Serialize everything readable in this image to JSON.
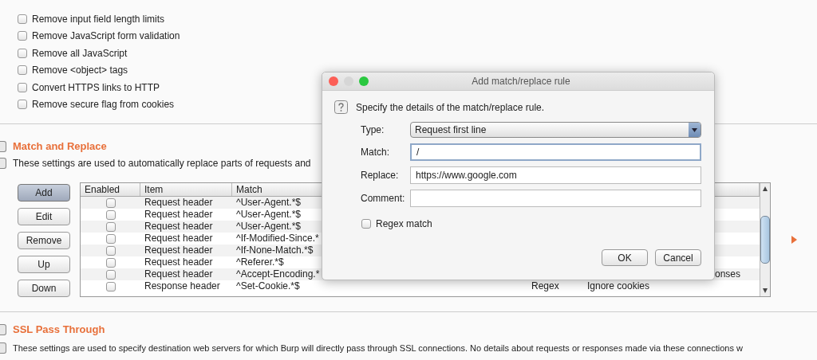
{
  "options": [
    {
      "label": "Remove input field length limits",
      "checked": false
    },
    {
      "label": "Remove JavaScript form validation",
      "checked": false
    },
    {
      "label": "Remove all JavaScript",
      "checked": false
    },
    {
      "label": "Remove <object> tags",
      "checked": false
    },
    {
      "label": "Convert HTTPS links to HTTP",
      "checked": false
    },
    {
      "label": "Remove secure flag from cookies",
      "checked": false
    }
  ],
  "match_replace": {
    "title": "Match and Replace",
    "description": "These settings are used to automatically replace parts of requests and",
    "buttons": [
      {
        "label": "Add",
        "selected": true
      },
      {
        "label": "Edit",
        "selected": false
      },
      {
        "label": "Remove",
        "selected": false
      },
      {
        "label": "Up",
        "selected": false
      },
      {
        "label": "Down",
        "selected": false
      }
    ],
    "table": {
      "columns": [
        "Enabled",
        "Item",
        "Match"
      ],
      "rows": [
        {
          "enabled": false,
          "item": "Request header",
          "match": "^User-Agent.*$"
        },
        {
          "enabled": false,
          "item": "Request header",
          "match": "^User-Agent.*$"
        },
        {
          "enabled": false,
          "item": "Request header",
          "match": "^User-Agent.*$"
        },
        {
          "enabled": false,
          "item": "Request header",
          "match": "^If-Modified-Since.*"
        },
        {
          "enabled": false,
          "item": "Request header",
          "match": "^If-None-Match.*$"
        },
        {
          "enabled": false,
          "item": "Request header",
          "match": "^Referer.*$"
        },
        {
          "enabled": false,
          "item": "Request header",
          "match": "^Accept-Encoding.*",
          "column_6": "onses"
        },
        {
          "enabled": false,
          "item": "Response header",
          "match": "^Set-Cookie.*$",
          "column_4": "Regex",
          "column_5": "Ignore cookies"
        }
      ]
    }
  },
  "ssl_pass_through": {
    "title": "SSL Pass Through",
    "description": "These settings are used to specify destination web servers for which Burp will directly pass through SSL connections. No details about requests or responses made via these connections w"
  },
  "dialog": {
    "title": "Add match/replace rule",
    "message": "Specify the details of the match/replace rule.",
    "type_label": "Type:",
    "type_value": "Request first line",
    "match_label": "Match:",
    "match_value": "/",
    "replace_label": "Replace:",
    "replace_value": "https://www.google.com",
    "comment_label": "Comment:",
    "regex_match": {
      "label": "Regex match",
      "checked": false
    },
    "buttons": [
      "OK",
      "Cancel"
    ]
  }
}
